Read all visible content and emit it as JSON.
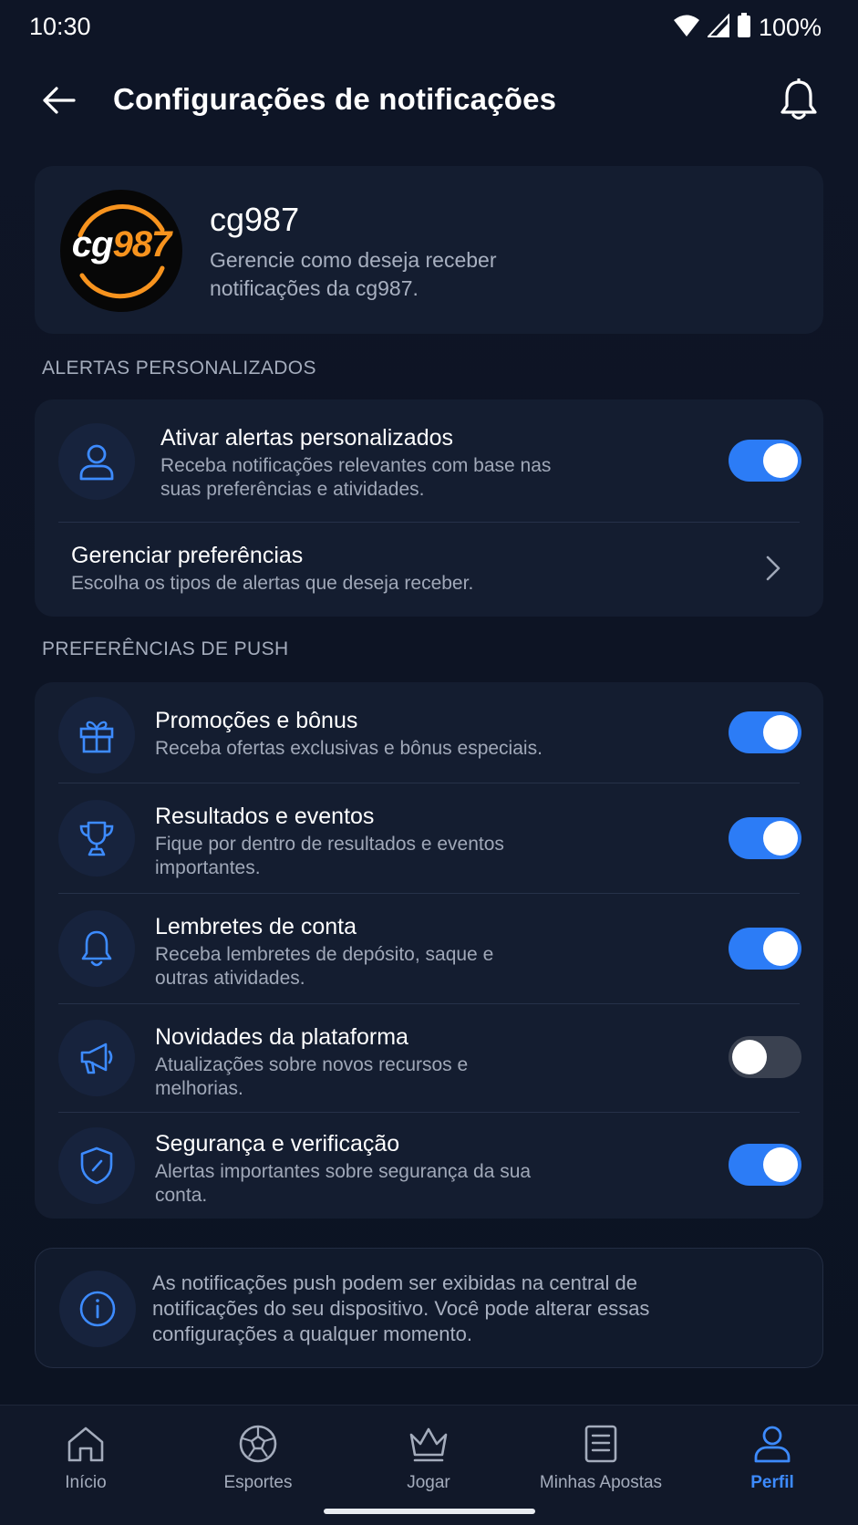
{
  "status_bar": {
    "time": "10:30",
    "battery": "100%"
  },
  "header": {
    "title": "Configurações de notificações"
  },
  "brand": {
    "logo_text_a": "cg",
    "logo_text_b": "987",
    "name": "cg987",
    "description": "Gerencie como deseja receber notificações da cg987."
  },
  "sections": {
    "alerts_label": "ALERTAS PERSONALIZADOS",
    "push_label": "PREFERÊNCIAS DE PUSH"
  },
  "alerts": {
    "activate": {
      "title": "Ativar alertas personalizados",
      "description": "Receba notificações relevantes com base nas suas preferências e atividades.",
      "enabled": true
    },
    "manage": {
      "title": "Gerenciar preferências",
      "description": "Escolha os tipos de alertas que deseja receber."
    }
  },
  "push": [
    {
      "icon": "gift-icon",
      "title": "Promoções e bônus",
      "description": "Receba ofertas exclusivas e bônus especiais.",
      "enabled": true
    },
    {
      "icon": "trophy-icon",
      "title": "Resultados e eventos",
      "description": "Fique por dentro de resultados e eventos importantes.",
      "enabled": true
    },
    {
      "icon": "bell-icon",
      "title": "Lembretes de conta",
      "description": "Receba lembretes de depósito, saque e outras atividades.",
      "enabled": true
    },
    {
      "icon": "megaphone-icon",
      "title": "Novidades da plataforma",
      "description": "Atualizações sobre novos recursos e melhorias.",
      "enabled": false
    },
    {
      "icon": "shield-icon",
      "title": "Segurança e verificação",
      "description": "Alertas importantes sobre segurança da sua conta.",
      "enabled": true
    }
  ],
  "info": {
    "text": "As notificações push podem ser exibidas na central de notificações do seu dispositivo. Você pode alterar essas configurações a qualquer momento."
  },
  "nav": [
    {
      "icon": "home-icon",
      "label": "Início",
      "active": false
    },
    {
      "icon": "soccer-ball-icon",
      "label": "Esportes",
      "active": false
    },
    {
      "icon": "crown-icon",
      "label": "Jogar",
      "active": false
    },
    {
      "icon": "document-icon",
      "label": "Minhas Apostas",
      "active": false
    },
    {
      "icon": "user-icon",
      "label": "Perfil",
      "active": true
    }
  ],
  "colors": {
    "accent": "#2c7cf6",
    "background": "#0d1424",
    "card": "#141d30",
    "logo_orange": "#f7931e"
  }
}
